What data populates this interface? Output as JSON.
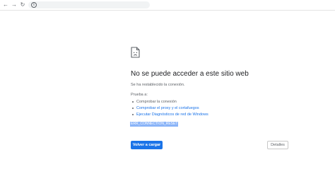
{
  "toolbar": {
    "back_icon": "←",
    "forward_icon": "→",
    "reload_icon": "↻",
    "info_icon": "i"
  },
  "error": {
    "icon": "sad-document-icon",
    "title": "No se puede acceder a este sitio web",
    "subtitle": "Se ha restablecido la conexión.",
    "try_label": "Prueba a:",
    "suggestions": [
      {
        "text": "Comprobar la conexión",
        "is_link": false
      },
      {
        "text": "Comprobar el proxy y el cortafuegos",
        "is_link": true
      },
      {
        "text": "Ejecutar Diagnósticos de red de Windows",
        "is_link": true
      }
    ],
    "error_code": "ERR_CONNECTION_RESET",
    "reload_label": "Volver a cargar",
    "details_label": "Detalles"
  },
  "colors": {
    "link": "#1a73e8",
    "primary_button": "#1a73e8",
    "error_code_highlight": "#8ab4f8",
    "secondary_text": "#5f6368"
  }
}
